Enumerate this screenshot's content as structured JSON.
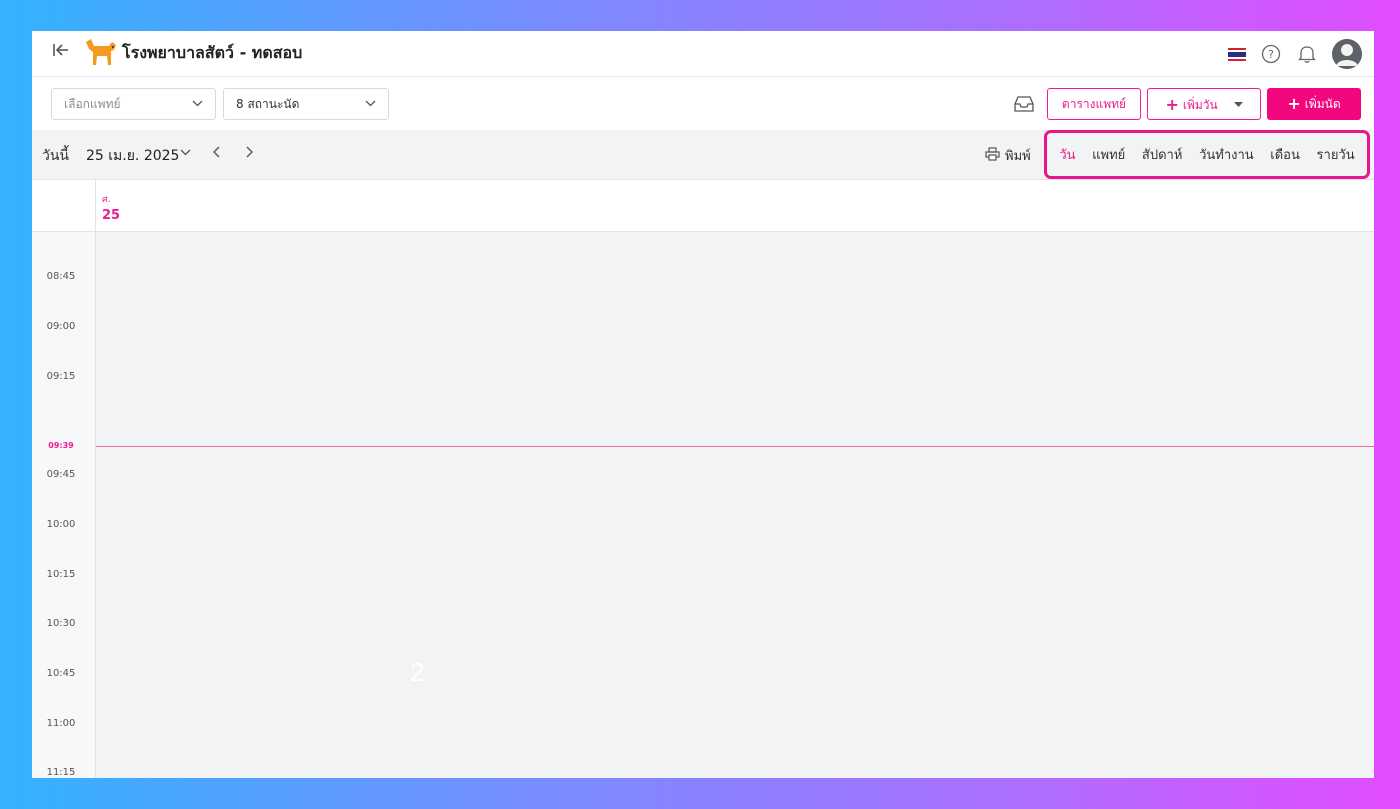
{
  "header": {
    "title": "โรงพยาบาลสัตว์ - ทดสอบ",
    "icons": [
      "collapse-icon",
      "dog-logo",
      "thai-flag-icon",
      "help-icon",
      "bell-icon",
      "avatar"
    ],
    "colors": {
      "accent": "#ec1c8c",
      "primary_button": "#f2077e"
    }
  },
  "toolbar": {
    "doctor_select_placeholder": "เลือกแพทย์",
    "status_select_value": "8 สถานะนัด",
    "doctor_schedule_label": "ตารางแพทย์",
    "add_day_label": "เพิ่มวัน",
    "add_appointment_label": "เพิ่มนัด"
  },
  "datebar": {
    "today_label": "วันนี้",
    "current_date": "25 เม.ย. 2025",
    "print_label": "พิมพ์",
    "views": [
      {
        "label": "วัน",
        "active": true
      },
      {
        "label": "แพทย์",
        "active": false
      },
      {
        "label": "สัปดาห์",
        "active": false
      },
      {
        "label": "วันทำงาน",
        "active": false
      },
      {
        "label": "เดือน",
        "active": false
      },
      {
        "label": "รายวัน",
        "active": false
      }
    ]
  },
  "day_header": {
    "day_abbr": "ศ.",
    "day_number": "25"
  },
  "grid": {
    "times": [
      "08:45",
      "09:00",
      "09:15",
      "09:45",
      "10:00",
      "10:15",
      "10:30",
      "10:45",
      "11:00",
      "11:15"
    ],
    "current_time": "09:39",
    "overlay_number": "2"
  }
}
